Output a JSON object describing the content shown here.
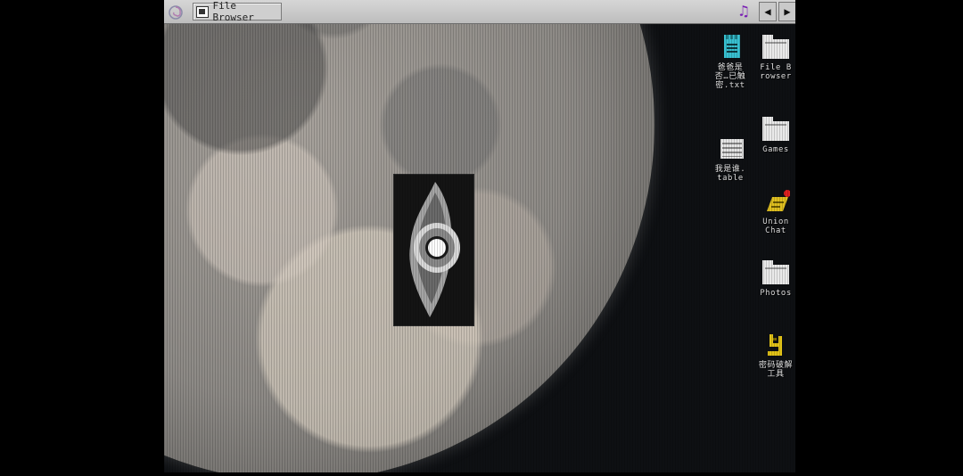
{
  "taskbar": {
    "start_icon": "swirl-logo-icon",
    "window_button_label": "File Browser",
    "music_icon": "music-note-icon",
    "nav_left_icon": "triangle-left-icon",
    "nav_right_icon": "triangle-right-icon",
    "nav_left_glyph": "◀",
    "nav_right_glyph": "▶",
    "music_glyph": "♫"
  },
  "desktop_icons": [
    {
      "label": "爸爸是否…已触密.txt",
      "icon": "text-file-icon"
    },
    {
      "label": "我是谁.table",
      "icon": "table-file-icon"
    },
    {
      "label": "File Browser",
      "icon": "folder-icon"
    },
    {
      "label": "Games",
      "icon": "folder-icon"
    },
    {
      "label": "Union Chat",
      "icon": "chat-app-icon"
    },
    {
      "label": "Photos",
      "icon": "folder-icon"
    },
    {
      "label": "密码破解工具",
      "icon": "crack-tool-icon"
    }
  ],
  "colors": {
    "taskbar": "#c8c8c8",
    "desktop_bg": "#0e1013",
    "icon_label": "#ececec",
    "music_note": "#7a1fb4",
    "text_file_accent": "#38c0d0",
    "chat_icon": "#e0c020",
    "crack_tool_icon": "#e2c318"
  }
}
